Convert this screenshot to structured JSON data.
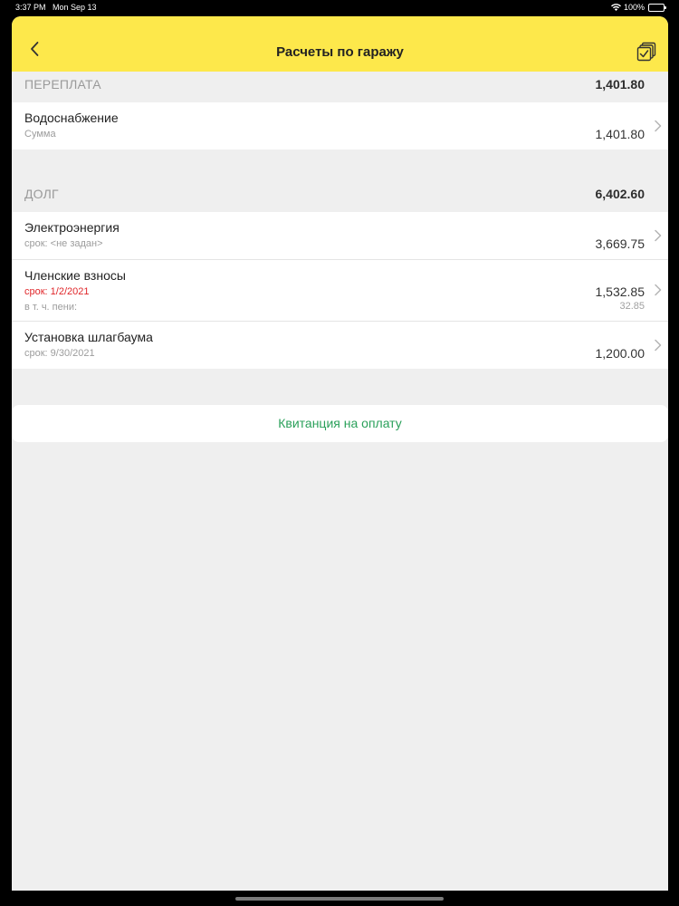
{
  "status_bar": {
    "time": "3:37 PM",
    "date": "Mon Sep 13",
    "battery": "100%"
  },
  "navbar": {
    "title": "Расчеты по гаражу",
    "back_icon": "chevron-left-icon",
    "action_icon": "copy-check-icon"
  },
  "overpayment": {
    "label": "ПЕРЕПЛАТА",
    "total": "1,401.80",
    "items": [
      {
        "title": "Водоснабжение",
        "subtitle": "Сумма",
        "amount": "1,401.80"
      }
    ]
  },
  "debt": {
    "label": "ДОЛГ",
    "total": "6,402.60",
    "items": [
      {
        "title": "Электроэнергия",
        "subtitle": "срок: <не задан>",
        "amount": "3,669.75"
      },
      {
        "title": "Членские взносы",
        "subtitle": "срок: 1/2/2021",
        "subtitle2": "в т. ч. пени:",
        "amount": "1,532.85",
        "amount2": "32.85"
      },
      {
        "title": "Установка шлагбаума",
        "subtitle": "срок: 9/30/2021",
        "amount": "1,200.00"
      }
    ]
  },
  "pay_button": {
    "label": "Квитанция на оплату"
  },
  "colors": {
    "navbar": "#fde84b",
    "overdue": "#e0262a",
    "action": "#2aa05a"
  }
}
